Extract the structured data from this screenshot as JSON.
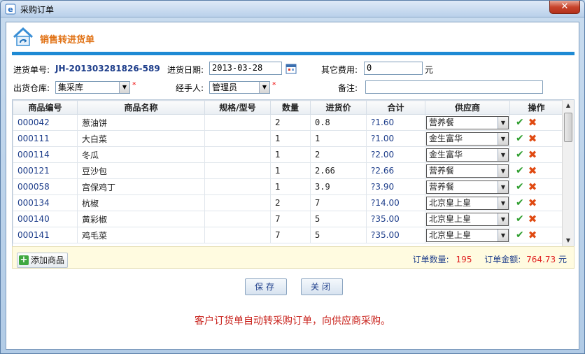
{
  "window": {
    "title": "采购订单",
    "close_glyph": "✕"
  },
  "header": {
    "title": "销售转进货单"
  },
  "form": {
    "order_no_label": "进货单号:",
    "order_no": "JH-201303281826-589",
    "date_label": "进货日期:",
    "date": "2013-03-28",
    "other_fee_label": "其它费用:",
    "other_fee": "0",
    "other_fee_unit": "元",
    "warehouse_label": "出货仓库:",
    "warehouse": "集采库",
    "handler_label": "经手人:",
    "handler": "管理员",
    "remark_label": "备注:",
    "remark": "",
    "required_mark": "*"
  },
  "table": {
    "columns": [
      "商品编号",
      "商品名称",
      "规格/型号",
      "数量",
      "进货价",
      "合计",
      "供应商",
      "操作"
    ],
    "rows": [
      {
        "code": "000042",
        "name": "葱油饼",
        "spec": "",
        "qty": "2",
        "price": "0.8",
        "total": "?1.60",
        "supplier": "营养餐"
      },
      {
        "code": "000111",
        "name": "大白菜",
        "spec": "",
        "qty": "1",
        "price": "1",
        "total": "?1.00",
        "supplier": "金生富华"
      },
      {
        "code": "000114",
        "name": "冬瓜",
        "spec": "",
        "qty": "1",
        "price": "2",
        "total": "?2.00",
        "supplier": "金生富华"
      },
      {
        "code": "000121",
        "name": "豆沙包",
        "spec": "",
        "qty": "1",
        "price": "2.66",
        "total": "?2.66",
        "supplier": "营养餐"
      },
      {
        "code": "000058",
        "name": "宫保鸡丁",
        "spec": "",
        "qty": "1",
        "price": "3.9",
        "total": "?3.90",
        "supplier": "营养餐"
      },
      {
        "code": "000134",
        "name": "杭椒",
        "spec": "",
        "qty": "2",
        "price": "7",
        "total": "?14.00",
        "supplier": "北京皇上皇"
      },
      {
        "code": "000140",
        "name": "黄彩椒",
        "spec": "",
        "qty": "7",
        "price": "5",
        "total": "?35.00",
        "supplier": "北京皇上皇"
      },
      {
        "code": "000141",
        "name": "鸡毛菜",
        "spec": "",
        "qty": "7",
        "price": "5",
        "total": "?35.00",
        "supplier": "北京皇上皇"
      }
    ]
  },
  "footer": {
    "add_label": "添加商品",
    "count_label": "订单数量:",
    "count": "195",
    "amount_label": "订单金额:",
    "amount": "764.73",
    "amount_unit": "元"
  },
  "buttons": {
    "save": "保存",
    "close": "关闭"
  },
  "notice": "客户订货单自动转采购订单，向供应商采购。",
  "colors": {
    "accent": "#1e8ad4",
    "header_title": "#e07012",
    "notice": "#c8201a"
  }
}
